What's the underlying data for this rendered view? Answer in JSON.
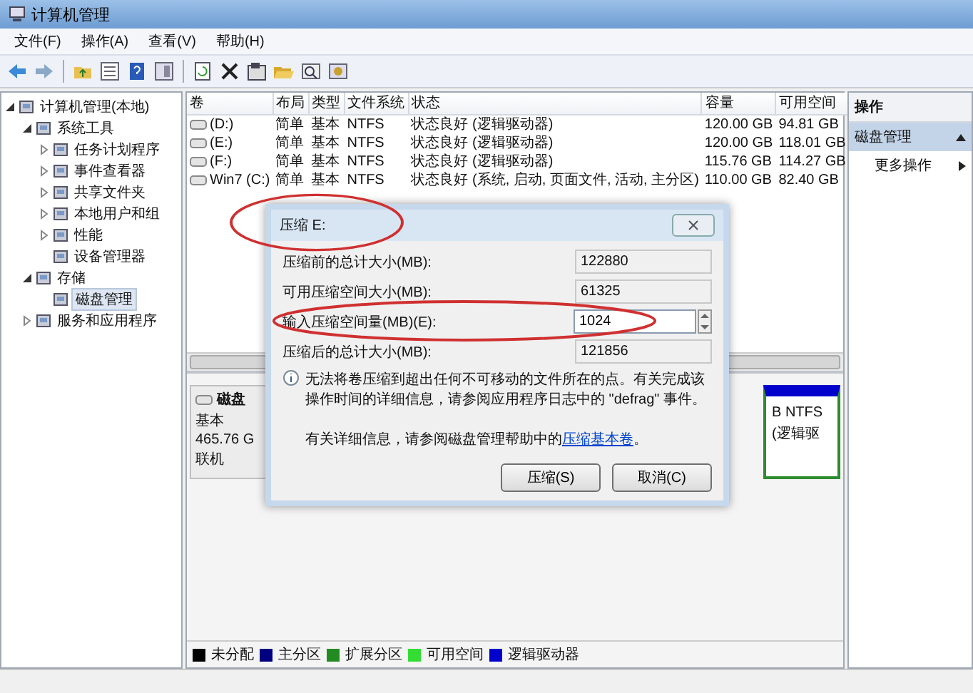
{
  "window": {
    "title": "计算机管理"
  },
  "menu": [
    "文件(F)",
    "操作(A)",
    "查看(V)",
    "帮助(H)"
  ],
  "tree": [
    {
      "label": "计算机管理(本地)",
      "selected": false,
      "expanded": true,
      "children": [
        {
          "label": "系统工具",
          "selected": false,
          "expanded": true,
          "children": [
            {
              "label": "任务计划程序",
              "selected": false,
              "expanded": false
            },
            {
              "label": "事件查看器",
              "selected": false,
              "expanded": false
            },
            {
              "label": "共享文件夹",
              "selected": false,
              "expanded": false
            },
            {
              "label": "本地用户和组",
              "selected": false,
              "expanded": false
            },
            {
              "label": "性能",
              "selected": false,
              "expanded": false
            },
            {
              "label": "设备管理器",
              "selected": false
            }
          ]
        },
        {
          "label": "存储",
          "selected": false,
          "expanded": true,
          "children": [
            {
              "label": "磁盘管理",
              "selected": true
            }
          ]
        },
        {
          "label": "服务和应用程序",
          "selected": false,
          "expanded": false
        }
      ]
    }
  ],
  "volumes": {
    "columns": [
      "卷",
      "布局",
      "类型",
      "文件系统",
      "状态",
      "容量",
      "可用空间"
    ],
    "rows": [
      [
        "(D:)",
        "简单",
        "基本",
        "NTFS",
        "状态良好 (逻辑驱动器)",
        "120.00 GB",
        "94.81 GB"
      ],
      [
        "(E:)",
        "简单",
        "基本",
        "NTFS",
        "状态良好 (逻辑驱动器)",
        "120.00 GB",
        "118.01 GB"
      ],
      [
        "(F:)",
        "简单",
        "基本",
        "NTFS",
        "状态良好 (逻辑驱动器)",
        "115.76 GB",
        "114.27 GB"
      ],
      [
        "Win7 (C:)",
        "简单",
        "基本",
        "NTFS",
        "状态良好 (系统, 启动, 页面文件, 活动, 主分区)",
        "110.00 GB",
        "82.40 GB"
      ]
    ]
  },
  "disk": {
    "name": "磁盘",
    "type": "基本",
    "size": "465.76 G",
    "status": "联机",
    "partition_lines": [
      "B NTFS",
      "(逻辑驱"
    ]
  },
  "legend": [
    {
      "label": "未分配",
      "color": "#000000"
    },
    {
      "label": "主分区",
      "color": "#000080"
    },
    {
      "label": "扩展分区",
      "color": "#228b22"
    },
    {
      "label": "可用空间",
      "color": "#33dd33"
    },
    {
      "label": "逻辑驱动器",
      "color": "#0000cc"
    }
  ],
  "actions": {
    "header": "操作",
    "section": "磁盘管理",
    "items": [
      "更多操作"
    ]
  },
  "dialog": {
    "title": "压缩 E:",
    "fields": [
      {
        "label": "压缩前的总计大小(MB):",
        "value": "122880",
        "kind": "readonly"
      },
      {
        "label": "可用压缩空间大小(MB):",
        "value": "61325",
        "kind": "readonly"
      },
      {
        "label": "输入压缩空间量(MB)(E):",
        "value": "1024",
        "kind": "spin"
      },
      {
        "label": "压缩后的总计大小(MB):",
        "value": "121856",
        "kind": "readonly"
      }
    ],
    "info": "无法将卷压缩到超出任何不可移动的文件所在的点。有关完成该操作时间的详细信息，请参阅应用程序日志中的 \"defrag\" 事件。",
    "help_prefix": "有关详细信息，请参阅磁盘管理帮助中的",
    "help_link": "压缩基本卷",
    "help_suffix": "。",
    "buttons": [
      "压缩(S)",
      "取消(C)"
    ]
  }
}
